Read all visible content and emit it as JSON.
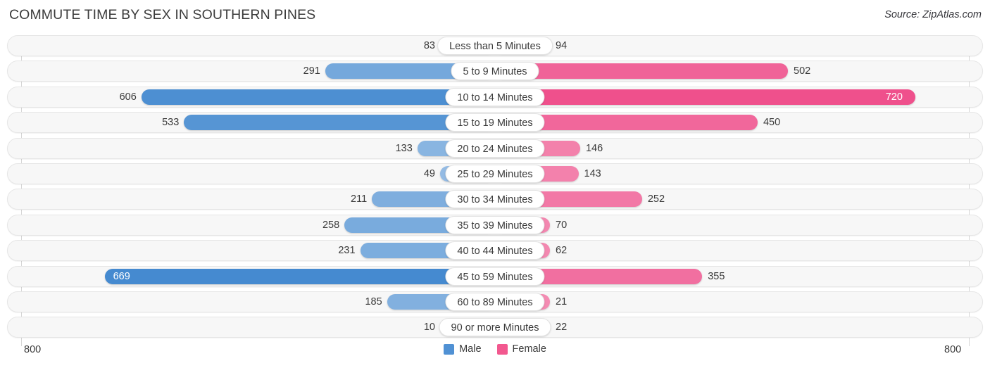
{
  "header": {
    "title": "COMMUTE TIME BY SEX IN SOUTHERN PINES",
    "source": "Source: ZipAtlas.com"
  },
  "axis": {
    "left_max_label": "800",
    "right_max_label": "800"
  },
  "legend": {
    "items": [
      {
        "label": "Male",
        "color": "#5091d4"
      },
      {
        "label": "Female",
        "color": "#f2588f"
      }
    ]
  },
  "chart_data": {
    "type": "bar",
    "orientation": "horizontal-diverging",
    "title": "COMMUTE TIME BY SEX IN SOUTHERN PINES",
    "xlabel": "",
    "ylabel": "",
    "xlim": [
      800,
      800
    ],
    "axis_max": 800,
    "grid": true,
    "legend_position": "bottom-center",
    "categories": [
      "Less than 5 Minutes",
      "5 to 9 Minutes",
      "10 to 14 Minutes",
      "15 to 19 Minutes",
      "20 to 24 Minutes",
      "25 to 29 Minutes",
      "30 to 34 Minutes",
      "35 to 39 Minutes",
      "40 to 44 Minutes",
      "45 to 59 Minutes",
      "60 to 89 Minutes",
      "90 or more Minutes"
    ],
    "series": [
      {
        "name": "Male",
        "color": "#5091d4",
        "side": "left",
        "values": [
          83,
          291,
          606,
          533,
          133,
          49,
          211,
          258,
          231,
          669,
          185,
          10
        ],
        "labels": [
          "83",
          "291",
          "606",
          "533",
          "133",
          "49",
          "211",
          "258",
          "231",
          "669",
          "185",
          "10"
        ]
      },
      {
        "name": "Female",
        "color": "#f2588f",
        "side": "right",
        "values": [
          94,
          502,
          720,
          450,
          146,
          143,
          252,
          70,
          62,
          355,
          21,
          22
        ],
        "labels": [
          "94",
          "502",
          "720",
          "450",
          "146",
          "143",
          "252",
          "70",
          "62",
          "355",
          "21",
          "22"
        ]
      }
    ]
  }
}
